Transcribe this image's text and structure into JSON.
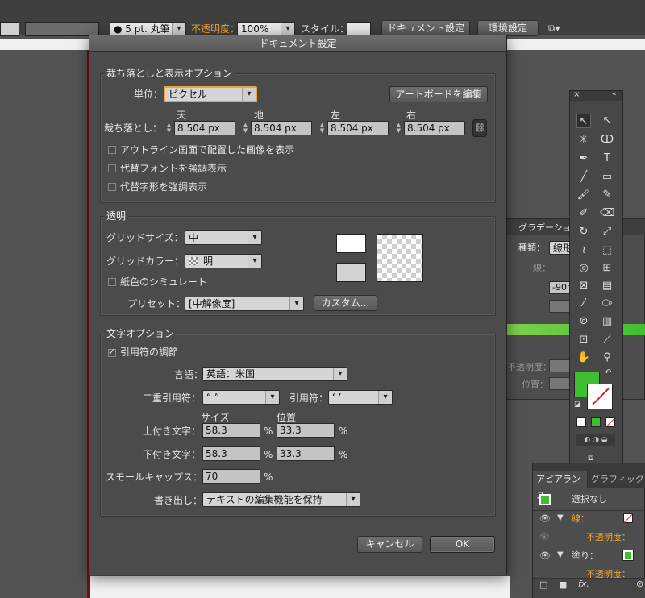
{
  "topbar": {
    "brush_label": "5 pt. 丸筆",
    "opacity_label": "不透明度：",
    "opacity_value": "100%",
    "style_label": "スタイル：",
    "doc_setup_button": "ドキュメント設定",
    "prefs_button": "環境設定"
  },
  "dialog": {
    "title": "ドキュメント設定",
    "bleed": {
      "section_title": "裁ち落としと表示オプション",
      "unit_label": "単位：",
      "unit_value": "ピクセル",
      "edit_artboards_button": "アートボードを編集",
      "bleed_label": "裁ち落とし：",
      "top_label": "天",
      "bottom_label": "地",
      "left_label": "左",
      "right_label": "右",
      "top_value": "8.504 px",
      "bottom_value": "8.504 px",
      "left_value": "8.504 px",
      "right_value": "8.504 px",
      "cb_outline": "アウトライン画面で配置した画像を表示",
      "cb_sub_font": "代替フォントを強調表示",
      "cb_sub_glyph": "代替字形を強調表示"
    },
    "transparency": {
      "section_title": "透明",
      "grid_size_label": "グリッドサイズ：",
      "grid_size_value": "中",
      "grid_color_label": "グリッドカラー：",
      "grid_color_value": "明",
      "simulate_paper": "紙色のシミュレート",
      "preset_label": "プリセット：",
      "preset_value": "[中解像度]",
      "custom_button": "カスタム..."
    },
    "type": {
      "section_title": "文字オプション",
      "use_typo_quotes": "引用符の調節",
      "language_label": "言語：",
      "language_value": "英語：米国",
      "double_quotes_label": "二重引用符：",
      "double_quotes_value": "“ ”",
      "single_quotes_label": "引用符：",
      "single_quotes_value": "‘ ’",
      "size_header": "サイズ",
      "position_header": "位置",
      "superscript_label": "上付き文字：",
      "superscript_size": "58.3",
      "superscript_pos": "33.3",
      "subscript_label": "下付き文字：",
      "subscript_size": "58.3",
      "subscript_pos": "33.3",
      "smallcaps_label": "スモールキャップス：",
      "smallcaps_value": "70",
      "percent": "%",
      "export_label": "書き出し：",
      "export_value": "テキストの編集機能を保持"
    },
    "cancel_button": "キャンセル",
    "ok_button": "OK"
  },
  "gradient_panel": {
    "title": "グラデーション",
    "type_label": "種類：",
    "type_value": "線形",
    "stroke_label": "線：",
    "angle_value": "-90°",
    "opacity_label": "不透明度：",
    "location_label": "位置："
  },
  "appearance_panel": {
    "tab_appearance": "アピアランス",
    "tab_graphic": "グラフィック",
    "no_selection": "選択なし",
    "stroke_label": "線：",
    "opacity_label": "不透明度：",
    "fill_label": "塗り：",
    "opacity_label_2": "不透明度：",
    "fx_label": "fx."
  },
  "colors": {
    "accent_orange": "#f2a338",
    "fill_green": "#3fbf2f",
    "dialog_bg": "#4b4b4b"
  }
}
